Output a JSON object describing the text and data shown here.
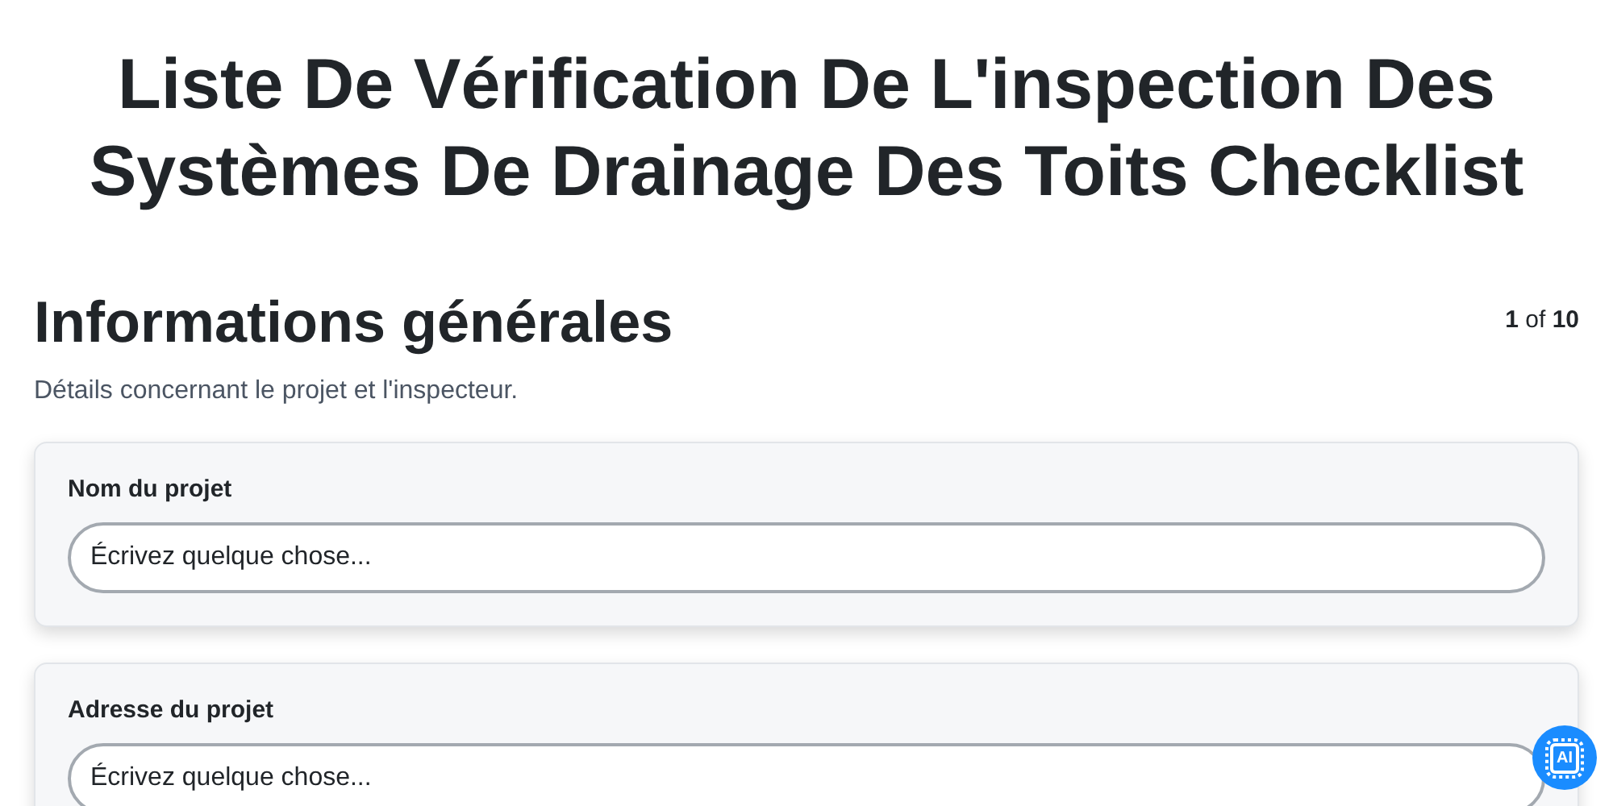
{
  "title": "Liste De Vérification De L'inspection Des Systèmes De Drainage Des Toits Checklist",
  "section": {
    "title": "Informations générales",
    "pager": "**1** of **10**",
    "description": "Détails concernant le projet et l'inspecteur."
  },
  "fields": [
    {
      "label": "Nom du projet",
      "placeholder": "Écrivez quelque chose..."
    },
    {
      "label": "Adresse du projet",
      "placeholder": "Écrivez quelque chose..."
    }
  ],
  "ai_button": {
    "label": "AI"
  }
}
